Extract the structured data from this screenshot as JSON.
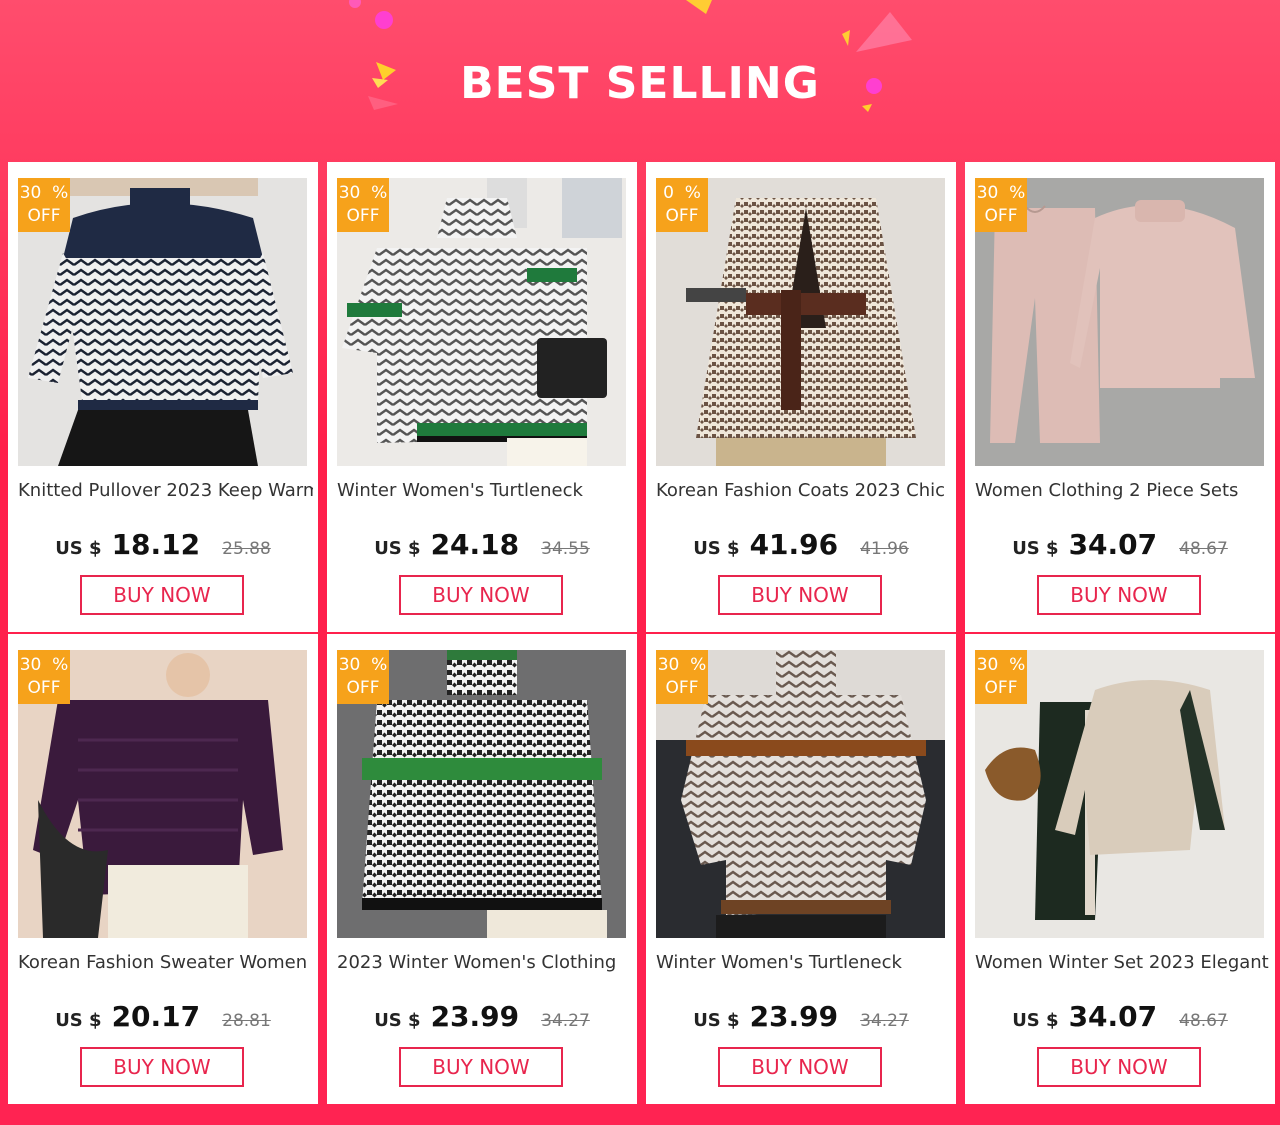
{
  "header": {
    "title": "BEST SELLING"
  },
  "colors": {
    "accent": "#e8254d",
    "badge": "#f6a21b",
    "background": "#ff2352"
  },
  "labels": {
    "currency": "US $",
    "buy": "BUY NOW"
  },
  "products": [
    {
      "title": "Knitted Pullover 2023 Keep Warm",
      "discount": "30  %",
      "off": "OFF",
      "price": "18.12",
      "old_price": "25.88",
      "image": "navy-chevron-sweater"
    },
    {
      "title": "Winter Women's Turtleneck",
      "discount": "30  %",
      "off": "OFF",
      "price": "24.18",
      "old_price": "34.55",
      "image": "grey-green-zigzag-turtleneck"
    },
    {
      "title": "Korean Fashion Coats 2023 Chic",
      "discount": "0  %",
      "off": "OFF",
      "price": "41.96",
      "old_price": "41.96",
      "image": "houndstooth-belted-blazer"
    },
    {
      "title": "Women Clothing 2 Piece Sets",
      "discount": "30  %",
      "off": "OFF",
      "price": "34.07",
      "old_price": "48.67",
      "image": "pink-knit-two-piece-set"
    },
    {
      "title": "Korean Fashion Sweater Women",
      "discount": "30  %",
      "off": "OFF",
      "price": "20.17",
      "old_price": "28.81",
      "image": "purple-knit-sweater"
    },
    {
      "title": "2023 Winter Women's Clothing",
      "discount": "30  %",
      "off": "OFF",
      "price": "23.99",
      "old_price": "34.27",
      "image": "houndstooth-green-stripe-turtleneck"
    },
    {
      "title": "Winter Women's Turtleneck",
      "discount": "30  %",
      "off": "OFF",
      "price": "23.99",
      "old_price": "34.27",
      "image": "brown-stripe-zigzag-turtleneck"
    },
    {
      "title": "Women Winter Set 2023 Elegant",
      "discount": "30  %",
      "off": "OFF",
      "price": "34.07",
      "old_price": "48.67",
      "image": "beige-black-knit-set"
    }
  ]
}
